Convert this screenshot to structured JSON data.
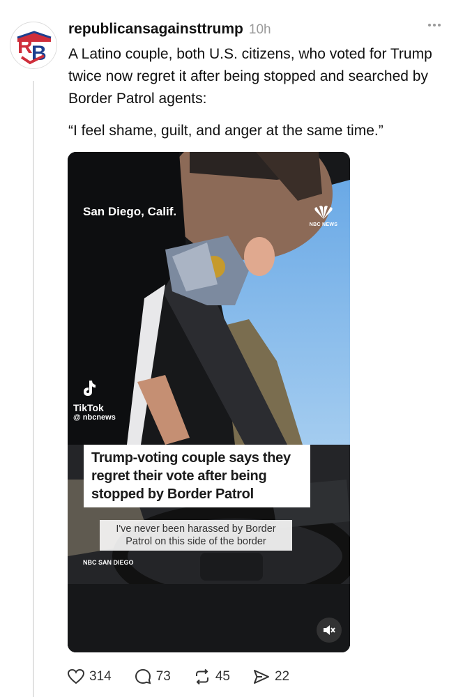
{
  "post": {
    "username": "republicansagainsttrump",
    "time": "10h",
    "avatar_text": "RB",
    "body": "A Latino couple, both U.S. citizens, who voted for Trump twice now regret it after being stopped and searched by Border Patrol agents:",
    "quote": "“I feel shame, guilt, and anger at the same time.”",
    "video": {
      "location": "San Diego, Calif.",
      "network_logo": "NBC NEWS",
      "tiktok_name": "TikTok",
      "tiktok_handle": "@ nbcnews",
      "headline": "Trump-voting couple says they regret their vote after being stopped by Border Patrol",
      "caption": "I've never been harassed by Border Patrol on this side of the border",
      "station": "NBC SAN DIEGO"
    },
    "actions": {
      "likes": "314",
      "replies": "73",
      "reposts": "45",
      "shares": "22"
    }
  },
  "colors": {
    "muted_gray": "#9a9a9a",
    "thread_line": "#e2e2e2",
    "text": "#111111"
  },
  "icons": [
    "more-icon",
    "heart-icon",
    "comment-icon",
    "repost-icon",
    "share-icon",
    "mute-icon",
    "tiktok-icon",
    "nbc-peacock-icon"
  ]
}
